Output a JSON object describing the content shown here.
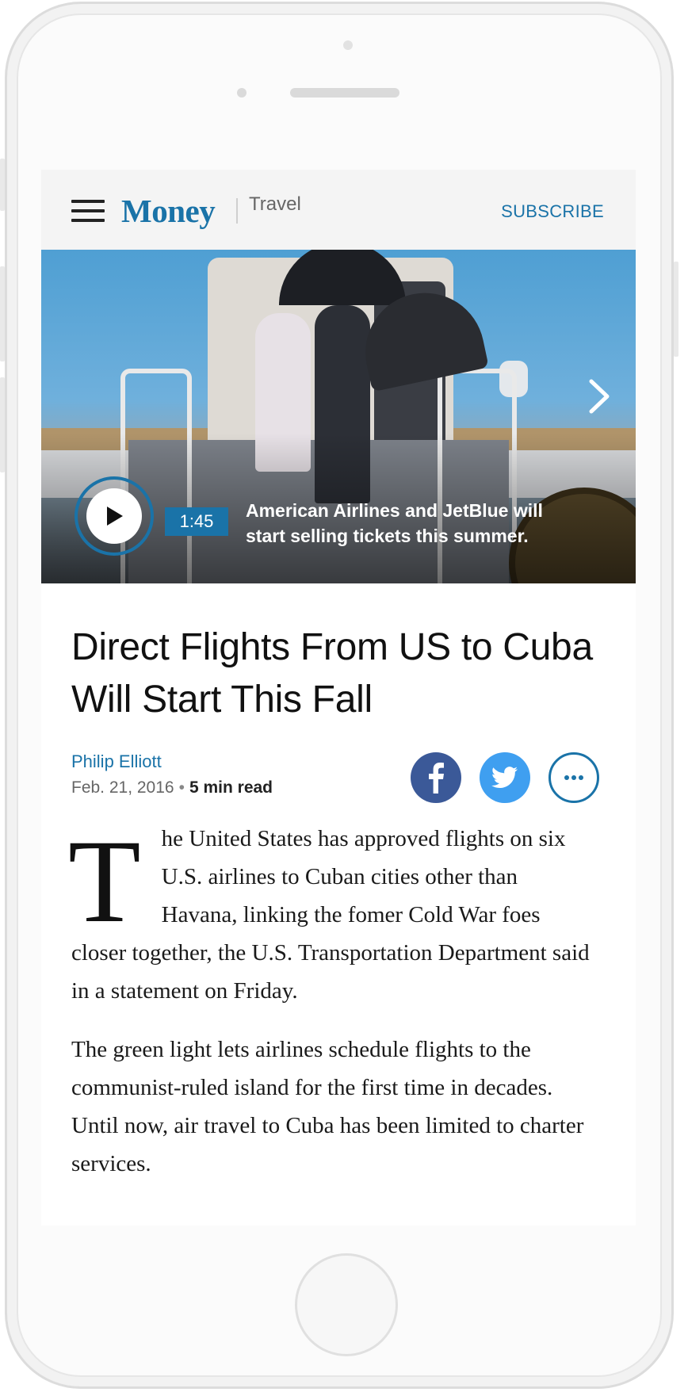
{
  "header": {
    "brand": "Money",
    "section": "Travel",
    "subscribe_label": "SUBSCRIBE"
  },
  "video": {
    "duration": "1:45",
    "caption": "American Airlines and JetBlue will start selling tickets this summer."
  },
  "article": {
    "title": "Direct Flights From US to Cuba Will Start This Fall",
    "author": "Philip Elliott",
    "date": "Feb. 21, 2016",
    "read_time": "5 min read",
    "drop_cap": "T",
    "paragraph1_rest": "he United States has approved flights on six U.S. airlines to Cuban cities other than Havana, linking the fomer Cold War foes closer together, the U.S. Transportation Department said in a statement on Friday.",
    "paragraph2": "The green light lets airlines schedule flights to the communist-ruled island for the first time in decades. Until now, air travel to Cuba has been limited to charter services."
  },
  "colors": {
    "accent": "#1a73a8",
    "facebook": "#3b5998",
    "twitter": "#3f9ff0"
  },
  "icons": [
    "hamburger-menu-icon",
    "play-icon",
    "chevron-right-icon",
    "facebook-icon",
    "twitter-icon",
    "more-icon"
  ]
}
